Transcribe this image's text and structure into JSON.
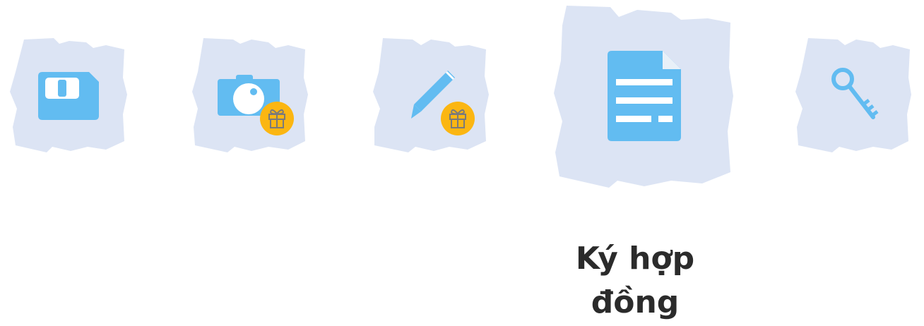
{
  "colors": {
    "blob_background": "#dce4f4",
    "icon_blue": "#62bcf1",
    "gift_badge": "#fbb612",
    "gift_stroke": "#7a7a7a",
    "label_text": "#2b2b2b"
  },
  "steps": [
    {
      "icon": "sim-card-icon",
      "has_gift_badge": false,
      "active": false
    },
    {
      "icon": "camera-icon",
      "has_gift_badge": true,
      "active": false
    },
    {
      "icon": "pencil-icon",
      "has_gift_badge": true,
      "active": false
    },
    {
      "icon": "document-icon",
      "has_gift_badge": false,
      "active": true
    },
    {
      "icon": "key-icon",
      "has_gift_badge": false,
      "active": false
    }
  ],
  "active_step": {
    "label": "Ký hợp đồng"
  }
}
